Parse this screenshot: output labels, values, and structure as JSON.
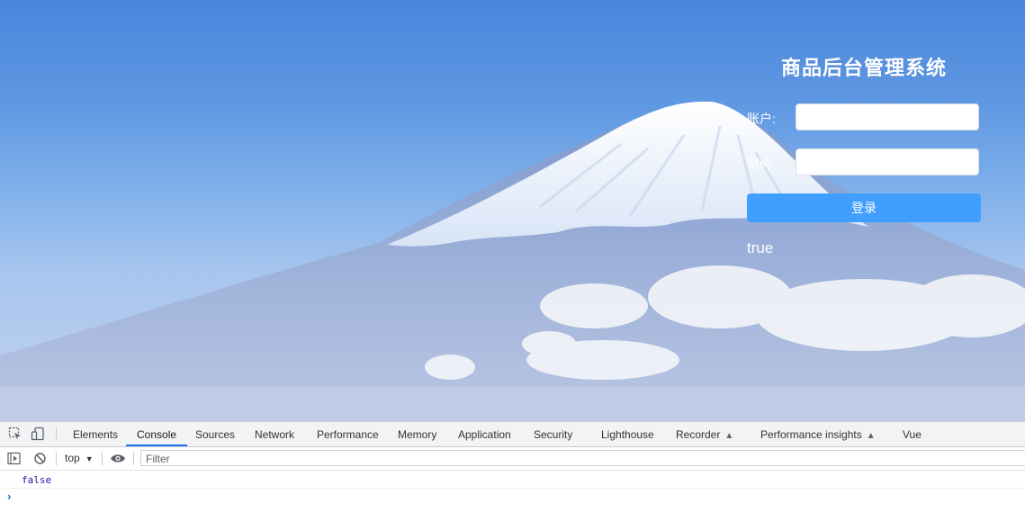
{
  "login": {
    "title": "商品后台管理系统",
    "account_label": "账户:",
    "account_value": "",
    "password_label": "密码:",
    "password_value": "",
    "submit_label": "登录",
    "result_text": "true"
  },
  "devtools": {
    "tabs": [
      "Elements",
      "Console",
      "Sources",
      "Network",
      "Performance",
      "Memory",
      "Application",
      "Security",
      "Lighthouse",
      "Recorder",
      "Performance insights",
      "Vue"
    ],
    "active_tab": "Console",
    "icons": [
      "inspect-element-icon",
      "device-toolbar-icon",
      "flask-icon"
    ],
    "toolbar": {
      "context": "top",
      "filter_placeholder": "Filter"
    },
    "console_output": [
      "false"
    ],
    "prompt_symbol": "›"
  },
  "colors": {
    "primary_button": "#409eff",
    "active_tab_underline": "#1a73e8",
    "console_value": "#1a1aa6"
  }
}
